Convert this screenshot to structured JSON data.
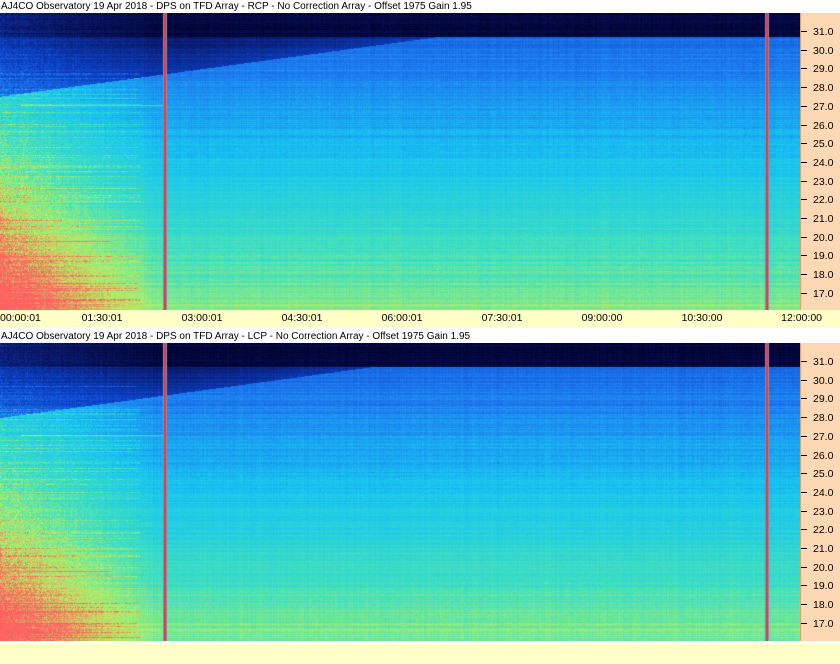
{
  "panels": [
    {
      "id": "rcp",
      "title": "AJ4CO Observatory 19 Apr 2018 - DPS on TFD Array  - RCP  -  No Correction Array  -  Offset 1975  Gain 1.95"
    },
    {
      "id": "lcp",
      "title": "AJ4CO Observatory 19 Apr 2018 - DPS on TFD Array  - LCP  -  No Correction Array  -  Offset 1975  Gain 1.95"
    }
  ],
  "y_ticks": [
    "31.0",
    "30.0",
    "29.0",
    "28.0",
    "27.0",
    "26.0",
    "25.0",
    "24.0",
    "23.0",
    "22.0",
    "21.0",
    "20.0",
    "19.0",
    "18.0",
    "17.0"
  ],
  "x_ticks": [
    "00:00:01",
    "01:30:01",
    "03:00:01",
    "04:30:01",
    "06:00:01",
    "07:30:01",
    "09:00:00",
    "10:30:00",
    "12:00:00"
  ],
  "chart_data": {
    "type": "heatmap",
    "panels": [
      "RCP",
      "LCP"
    ],
    "x_label": "",
    "y_label": "",
    "x_range": [
      "00:00:01",
      "12:00:00"
    ],
    "y_range": [
      16.5,
      31.8
    ],
    "y_ticks": [
      31.0,
      30.0,
      29.0,
      28.0,
      27.0,
      26.0,
      25.0,
      24.0,
      23.0,
      22.0,
      21.0,
      20.0,
      19.0,
      18.0,
      17.0
    ],
    "x_ticks": [
      "00:00:01",
      "01:30:01",
      "03:00:01",
      "04:30:01",
      "06:00:01",
      "07:30:01",
      "09:00:00",
      "10:30:00",
      "12:00:00"
    ],
    "vertical_markers": [
      "02:28",
      "11:32"
    ],
    "colormap": [
      "#00002a",
      "#0a1a6e",
      "#0b42c8",
      "#1d7bf0",
      "#18c5f0",
      "#40e0c0",
      "#b8f060",
      "#ff6060"
    ]
  }
}
